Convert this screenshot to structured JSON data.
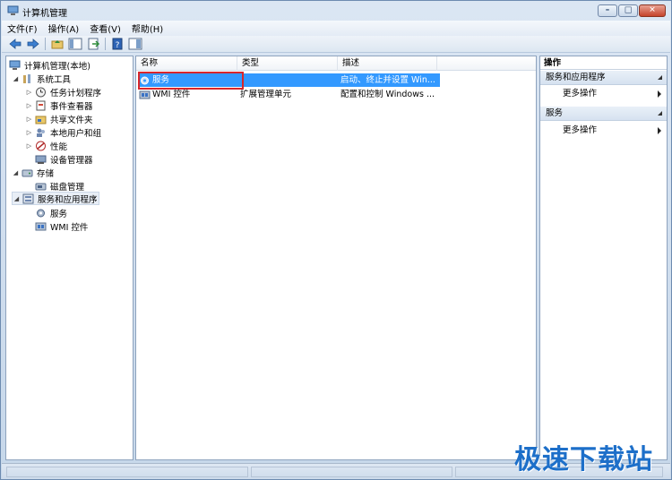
{
  "window": {
    "title": "计算机管理"
  },
  "menu": [
    "文件(F)",
    "操作(A)",
    "查看(V)",
    "帮助(H)"
  ],
  "tree": {
    "root": "计算机管理(本地)",
    "system_tools": "系统工具",
    "task_scheduler": "任务计划程序",
    "event_viewer": "事件查看器",
    "shared_folders": "共享文件夹",
    "local_users": "本地用户和组",
    "performance": "性能",
    "device_manager": "设备管理器",
    "storage": "存储",
    "disk_management": "磁盘管理",
    "services_apps": "服务和应用程序",
    "services": "服务",
    "wmi": "WMI 控件"
  },
  "list": {
    "columns": [
      "名称",
      "类型",
      "描述"
    ],
    "rows": [
      {
        "name": "服务",
        "type": "",
        "desc": "启动、终止并设置 Win..."
      },
      {
        "name": "WMI 控件",
        "type": "扩展管理单元",
        "desc": "配置和控制 Windows ..."
      }
    ]
  },
  "actions": {
    "title": "操作",
    "section1": "服务和应用程序",
    "more1": "更多操作",
    "section2": "服务",
    "more2": "更多操作"
  },
  "watermark": "极速下载站"
}
